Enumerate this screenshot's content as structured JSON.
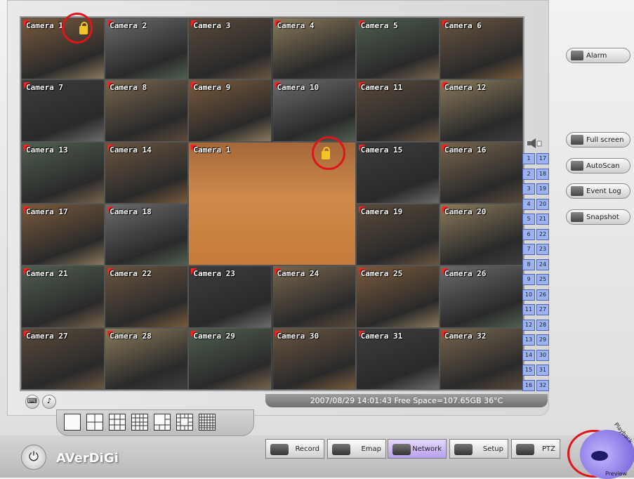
{
  "cameras": [
    {
      "label": "Camera 1"
    },
    {
      "label": "Camera 2"
    },
    {
      "label": "Camera 3"
    },
    {
      "label": "Camera 4"
    },
    {
      "label": "Camera 5"
    },
    {
      "label": "Camera 6"
    },
    {
      "label": "Camera 7"
    },
    {
      "label": "Camera 8"
    },
    {
      "label": "Camera 9"
    },
    {
      "label": "Camera 10"
    },
    {
      "label": "Camera 11"
    },
    {
      "label": "Camera 12"
    },
    {
      "label": "Camera 13"
    },
    {
      "label": "Camera 14"
    },
    {
      "label": "Camera 15"
    },
    {
      "label": "Camera 16"
    },
    {
      "label": "Camera 17"
    },
    {
      "label": "Camera 18"
    },
    {
      "label": "Camera 19"
    },
    {
      "label": "Camera 20"
    },
    {
      "label": "Camera 21"
    },
    {
      "label": "Camera 22"
    },
    {
      "label": "Camera 23"
    },
    {
      "label": "Camera 24"
    },
    {
      "label": "Camera 25"
    },
    {
      "label": "Camera 26"
    },
    {
      "label": "Camera 27"
    },
    {
      "label": "Camera 28"
    },
    {
      "label": "Camera 29"
    },
    {
      "label": "Camera 30"
    },
    {
      "label": "Camera 31"
    },
    {
      "label": "Camera 32"
    }
  ],
  "channels_left": [
    "1",
    "2",
    "3",
    "4",
    "5",
    "6",
    "7",
    "8",
    "9",
    "10",
    "11",
    "12",
    "13",
    "14",
    "15",
    "16"
  ],
  "channels_right": [
    "17",
    "18",
    "19",
    "20",
    "21",
    "22",
    "23",
    "24",
    "25",
    "26",
    "27",
    "28",
    "29",
    "30",
    "31",
    "32"
  ],
  "status": "2007/08/29 14:01:43  Free Space=107.65GB 36°C",
  "right_buttons": {
    "alarm": "Alarm",
    "full_screen": "Full screen",
    "autoscan": "AutoScan",
    "event_log": "Event Log",
    "snapshot": "Snapshot"
  },
  "tabs": {
    "record": "Record",
    "emap": "Emap",
    "network": "Network",
    "setup": "Setup",
    "ptz": "PTZ"
  },
  "brand": "AVerDiGi",
  "preview": {
    "preview_label": "Preview",
    "playback_label": "Playback"
  },
  "icons": [
    "alarm-icon",
    "fullscreen-icon",
    "autoscan-icon",
    "eventlog-icon",
    "snapshot-icon",
    "record-icon",
    "emap-icon",
    "network-icon",
    "setup-icon",
    "ptz-icon",
    "power-icon",
    "keyboard-icon",
    "audio-icon",
    "lock-icon",
    "speaker-icon",
    "eye-icon"
  ],
  "colors": {
    "alarm_flag": "#ff2020",
    "highlight_circle": "#e0141b",
    "channel_button": "#9db3f0",
    "network_tab": "#b5a0ee",
    "lock": "#f3c623"
  }
}
